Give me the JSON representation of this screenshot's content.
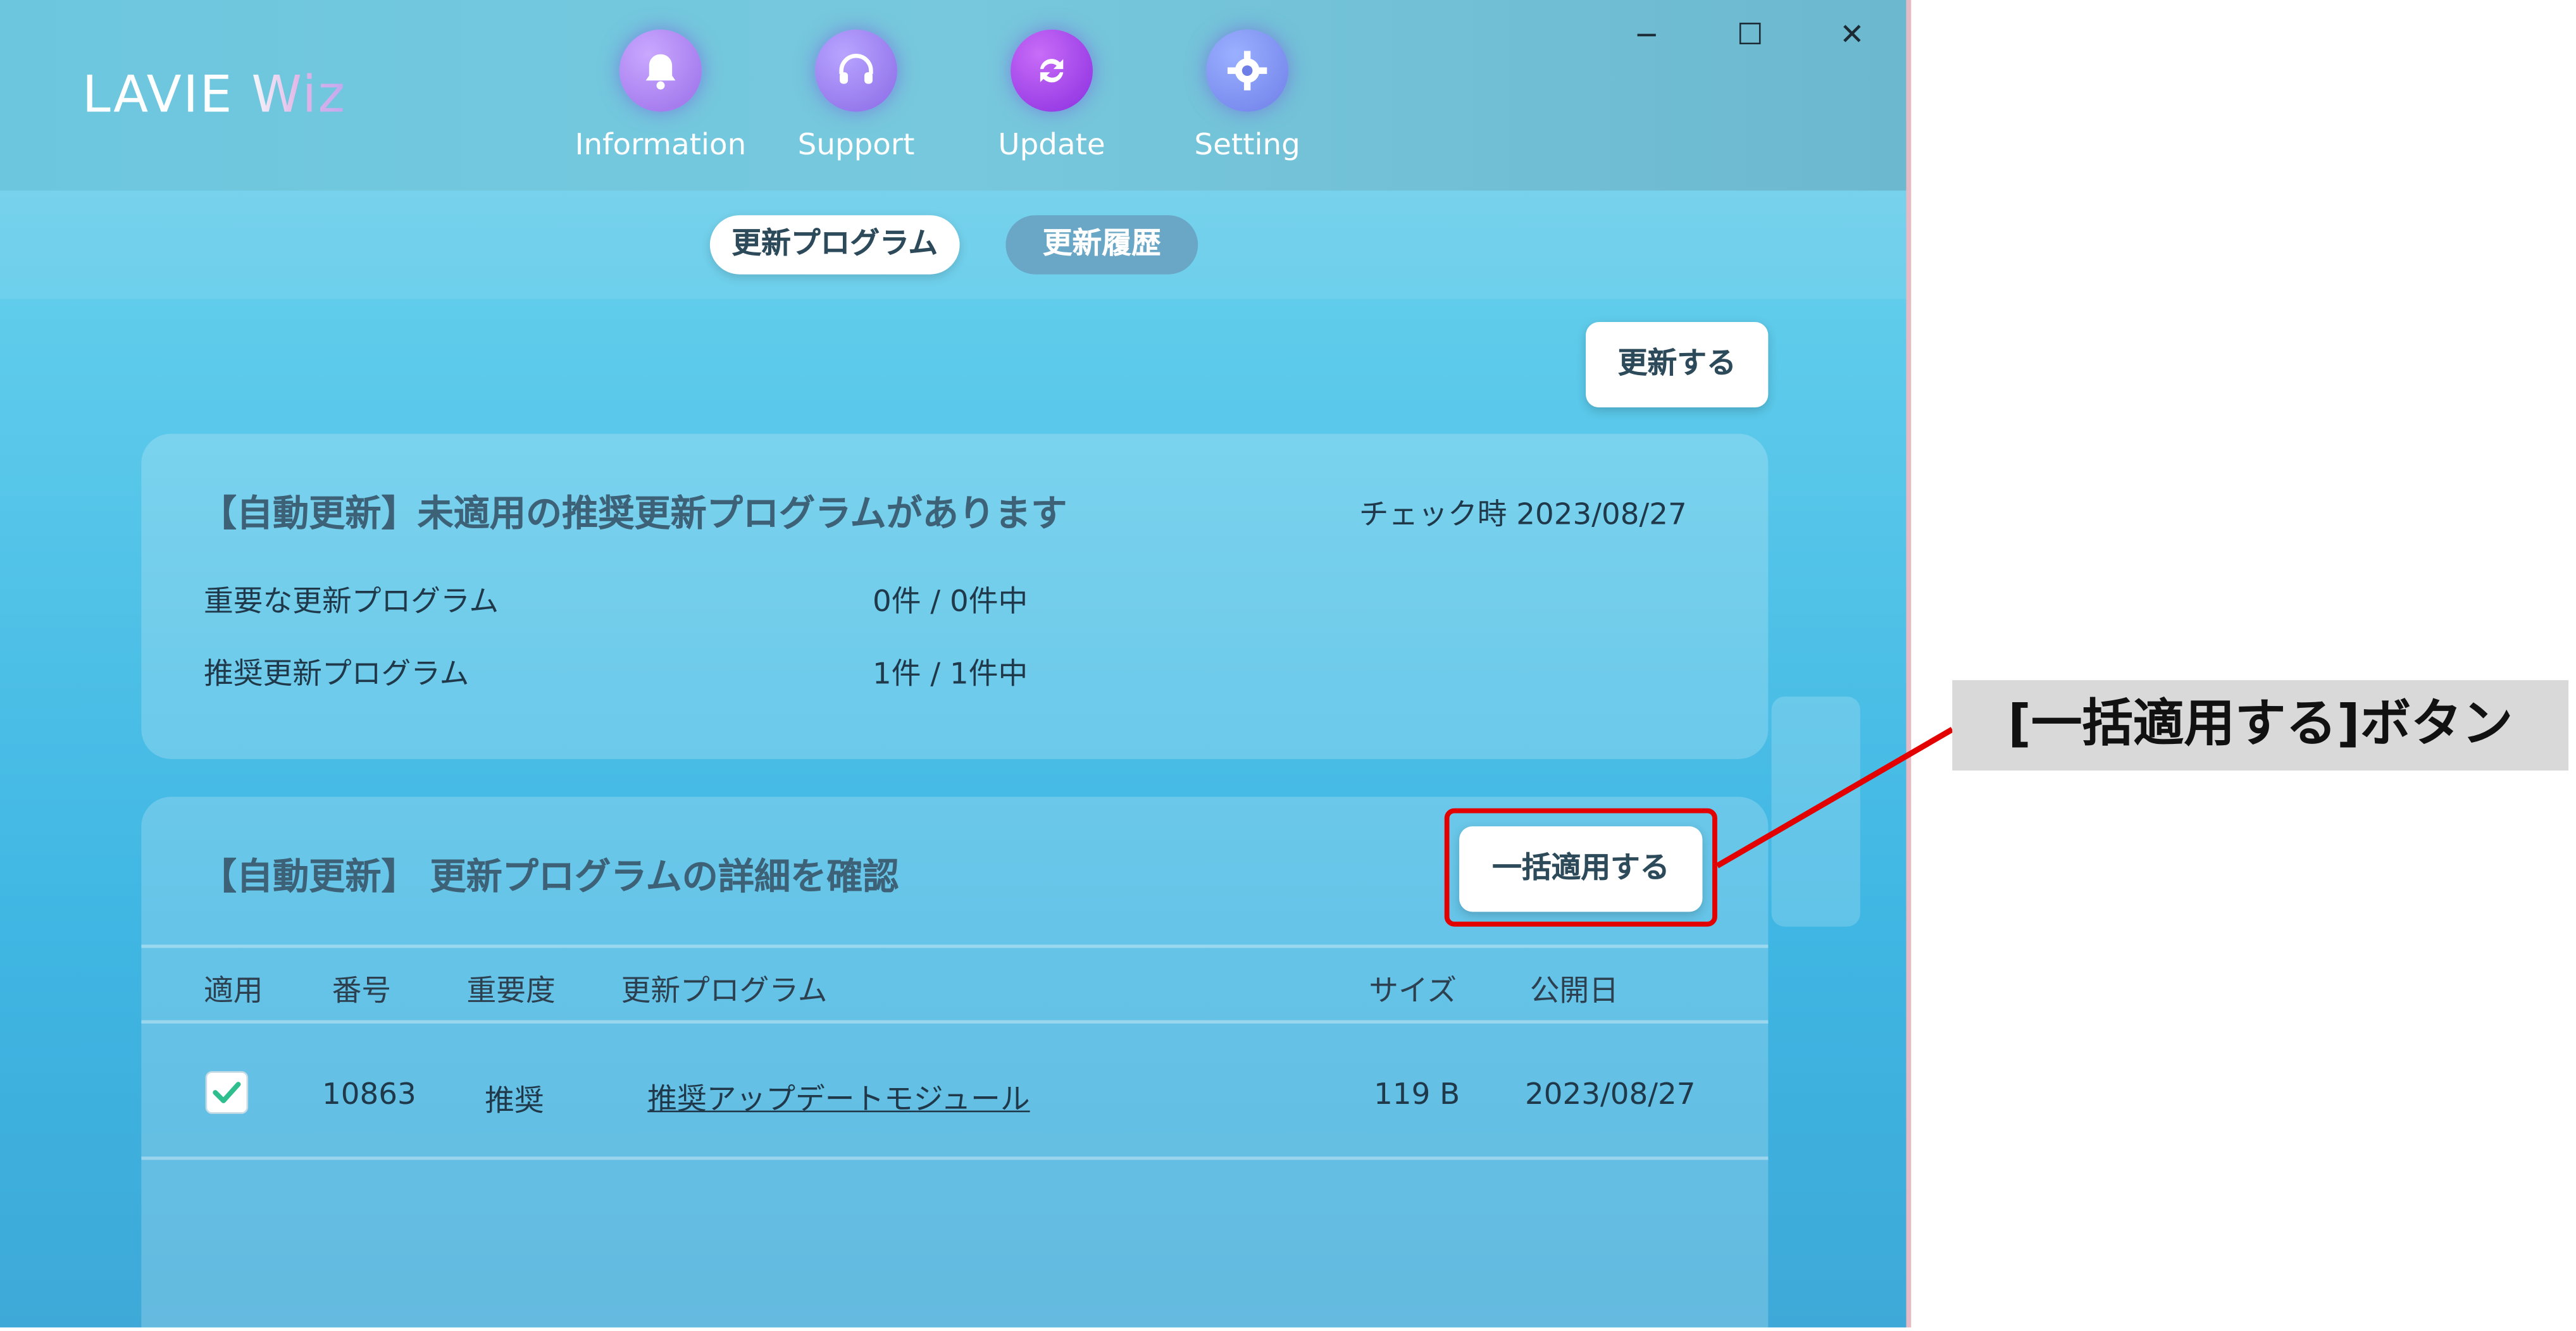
{
  "app": {
    "logo_main": "LAVIE ",
    "logo_accent": "Wiz",
    "window_controls": {
      "minimize": "−",
      "maximize": "☐",
      "close": "✕"
    }
  },
  "nav": [
    {
      "label": "Information",
      "icon": "bell-icon",
      "color": "#9b6ee8"
    },
    {
      "label": "Support",
      "icon": "headset-icon",
      "color": "#8a6ae6"
    },
    {
      "label": "Update",
      "icon": "refresh-icon",
      "color": "#8a2ee0"
    },
    {
      "label": "Setting",
      "icon": "gear-icon",
      "color": "#6f7fe8"
    }
  ],
  "tabs": {
    "active": "更新プログラム",
    "inactive": "更新履歴"
  },
  "update_button": "更新する",
  "summary": {
    "title": "【自動更新】未適用の推奨更新プログラムがあります",
    "checked": "チェック時 2023/08/27",
    "rows": [
      {
        "label": "重要な更新プログラム",
        "value": "0件 / 0件中"
      },
      {
        "label": "推奨更新プログラム",
        "value": "1件 / 1件中"
      }
    ]
  },
  "details": {
    "title": "【自動更新】 更新プログラムの詳細を確認",
    "apply_all_button": "一括適用する",
    "columns": [
      "適用",
      "番号",
      "重要度",
      "更新プログラム",
      "サイズ",
      "公開日"
    ],
    "rows": [
      {
        "checked": true,
        "number": "10863",
        "importance": "推奨",
        "program": "推奨アップデートモジュール",
        "size": "119 B",
        "date": "2023/08/27"
      }
    ]
  },
  "annotation": {
    "label": "[一括適用する]ボタン",
    "color": "#e20000"
  }
}
